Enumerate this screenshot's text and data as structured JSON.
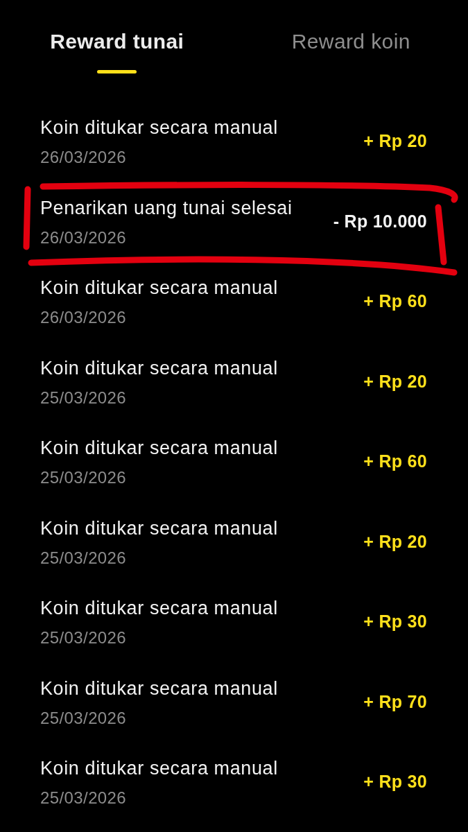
{
  "tabs": [
    {
      "label": "Reward tunai",
      "selected": true
    },
    {
      "label": "Reward koin",
      "selected": false
    }
  ],
  "rows": [
    {
      "title": "Koin ditukar secara manual",
      "date": "26/03/2026",
      "amount": "+ Rp 20",
      "kind": "credit",
      "circled": false
    },
    {
      "title": "Penarikan uang tunai selesai",
      "date": "26/03/2026",
      "amount": "- Rp 10.000",
      "kind": "debit",
      "circled": true
    },
    {
      "title": "Koin ditukar secara manual",
      "date": "26/03/2026",
      "amount": "+ Rp 60",
      "kind": "credit",
      "circled": false
    },
    {
      "title": "Koin ditukar secara manual",
      "date": "25/03/2026",
      "amount": "+ Rp 20",
      "kind": "credit",
      "circled": false
    },
    {
      "title": "Koin ditukar secara manual",
      "date": "25/03/2026",
      "amount": "+ Rp 60",
      "kind": "credit",
      "circled": false
    },
    {
      "title": "Koin ditukar secara manual",
      "date": "25/03/2026",
      "amount": "+ Rp 20",
      "kind": "credit",
      "circled": false
    },
    {
      "title": "Koin ditukar secara manual",
      "date": "25/03/2026",
      "amount": "+ Rp 30",
      "kind": "credit",
      "circled": false
    },
    {
      "title": "Koin ditukar secara manual",
      "date": "25/03/2026",
      "amount": "+ Rp 70",
      "kind": "credit",
      "circled": false
    },
    {
      "title": "Koin ditukar secara manual",
      "date": "25/03/2026",
      "amount": "+ Rp 30",
      "kind": "credit",
      "circled": false
    }
  ]
}
